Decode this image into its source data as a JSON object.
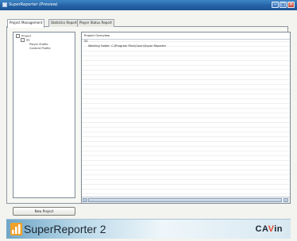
{
  "window": {
    "title": "SuperReporter (Preview)"
  },
  "tabs": [
    {
      "label": "Project Management",
      "active": true
    },
    {
      "label": "Statistics Report",
      "active": false
    },
    {
      "label": "Player Status Report",
      "active": false
    }
  ],
  "tree": {
    "root": "Project",
    "child": "SS",
    "leaves": [
      "Player Profile",
      "Content Profile"
    ]
  },
  "overview": {
    "header": "Project Overview",
    "lines": [
      "SS",
      "Working Folder: C:\\Program Files\\Cavin\\Super Reporter"
    ]
  },
  "buttons": {
    "new_project": "New Project"
  },
  "footer": {
    "brand": "SuperReporter 2",
    "company_prefix": "CA",
    "company_accent": "V",
    "company_suffix": "in"
  },
  "colors": {
    "titlebar": "#2360a3",
    "accent": "#e0472b"
  }
}
